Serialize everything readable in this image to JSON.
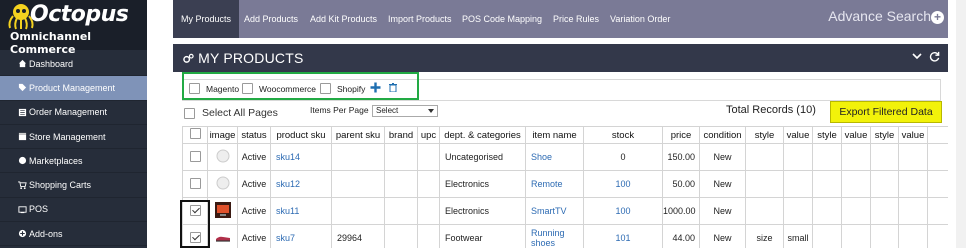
{
  "brand": {
    "name": "Octopus",
    "tagline": "Omnichannel Commerce"
  },
  "sidebar": {
    "items": [
      {
        "label": "Dashboard",
        "icon": "home-icon",
        "active": false
      },
      {
        "label": "Product Management",
        "icon": "tag-icon",
        "active": true
      },
      {
        "label": "Order Management",
        "icon": "list-icon",
        "active": false
      },
      {
        "label": "Store Management",
        "icon": "store-icon",
        "active": false
      },
      {
        "label": "Marketplaces",
        "icon": "globe-icon",
        "active": false
      },
      {
        "label": "Shopping Carts",
        "icon": "cart-icon",
        "active": false
      },
      {
        "label": "POS",
        "icon": "pos-icon",
        "active": false
      },
      {
        "label": "Add-ons",
        "icon": "addon-icon",
        "active": false
      }
    ]
  },
  "topnav": {
    "tabs": [
      {
        "label": "My Products",
        "active": true
      },
      {
        "label": "Add Products",
        "active": false
      },
      {
        "label": "Add Kit Products",
        "active": false
      },
      {
        "label": "Import Products",
        "active": false
      },
      {
        "label": "POS Code Mapping",
        "active": false
      },
      {
        "label": "Price Rules",
        "active": false
      },
      {
        "label": "Variation Order",
        "active": false
      }
    ],
    "advance_search": "Advance Search"
  },
  "panel": {
    "title": "MY PRODUCTS"
  },
  "channels": [
    "Magento",
    "Woocommerce",
    "Shopify"
  ],
  "controls": {
    "select_all": "Select All Pages",
    "items_per_page_label": "Items Per Page",
    "items_per_page_value": "Select",
    "total_records": "Total Records (10)",
    "export_button": "Export Filtered Data"
  },
  "table": {
    "headers": [
      "image",
      "status",
      "product sku",
      "parent sku",
      "brand",
      "upc",
      "dept. & categories",
      "item name",
      "stock",
      "price",
      "condition",
      "style",
      "value",
      "style",
      "value",
      "style",
      "value"
    ],
    "rows": [
      {
        "checked": false,
        "status": "Active",
        "sku": "sku14",
        "parent_sku": "",
        "brand": "",
        "upc": "",
        "category": "Uncategorised",
        "item_name": "Shoe",
        "stock": "0",
        "price": "150.00",
        "condition": "New",
        "style1": "",
        "value1": ""
      },
      {
        "checked": false,
        "status": "Active",
        "sku": "sku12",
        "parent_sku": "",
        "brand": "",
        "upc": "",
        "category": "Electronics",
        "item_name": "Remote",
        "stock": "100",
        "price": "50.00",
        "condition": "New",
        "style1": "",
        "value1": ""
      },
      {
        "checked": true,
        "status": "Active",
        "sku": "sku11",
        "parent_sku": "",
        "brand": "",
        "upc": "",
        "category": "Electronics",
        "item_name": "SmartTV",
        "stock": "100",
        "price": "1000.00",
        "condition": "New",
        "style1": "",
        "value1": ""
      },
      {
        "checked": true,
        "status": "Active",
        "sku": "sku7",
        "parent_sku": "29964",
        "brand": "",
        "upc": "",
        "category": "Footwear",
        "item_name": "Running shoes",
        "stock": "101",
        "price": "44.00",
        "condition": "New",
        "style1": "size",
        "value1": "small"
      }
    ]
  },
  "colors": {
    "sidebar_bg": "#262d3a",
    "sidebar_active": "#7f93b8",
    "topnav_bg": "#7a7a96",
    "panel_header": "#33384a",
    "export_bg": "#f2f20a",
    "link": "#2d6bb3",
    "channel_highlight": "#22aa44"
  }
}
